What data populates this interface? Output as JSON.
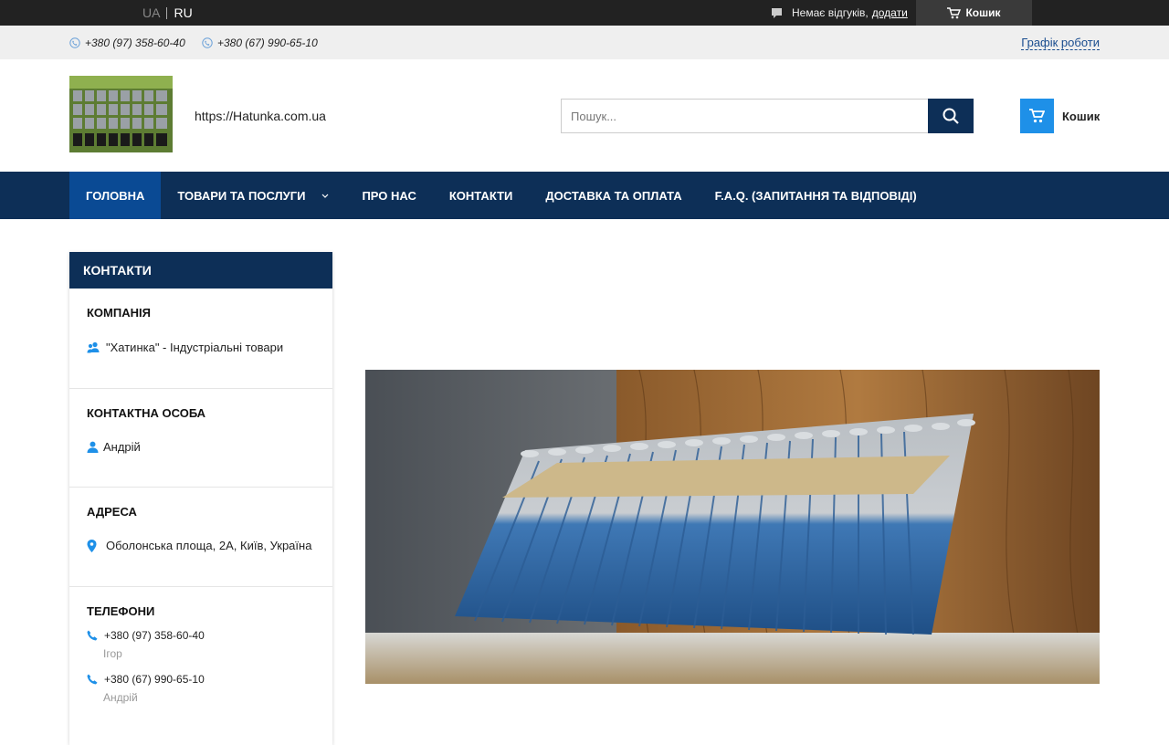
{
  "topbar": {
    "lang_ua": "UA",
    "lang_ru": "RU",
    "reviews_text": "Немає відгуків,",
    "reviews_add": "додати",
    "cart_label": "Кошик"
  },
  "strip": {
    "phone1": "+380 (97) 358-60-40",
    "phone2": "+380 (67) 990-65-10",
    "schedule": "Графік роботи"
  },
  "header": {
    "site_url": "https://Hatunka.com.ua",
    "search_placeholder": "Пошук...",
    "cart_label": "Кошик"
  },
  "nav": {
    "items": [
      {
        "label": "ГОЛОВНА"
      },
      {
        "label": "ТОВАРИ ТА ПОСЛУГИ"
      },
      {
        "label": "ПРО НАС"
      },
      {
        "label": "КОНТАКТИ"
      },
      {
        "label": "ДОСТАВКА ТА ОПЛАТА"
      },
      {
        "label": "F.A.Q. (ЗАПИТАННЯ ТА ВІДПОВІДІ)"
      }
    ]
  },
  "sidebar": {
    "title": "КОНТАКТИ",
    "company_title": "КОМПАНІЯ",
    "company_name": "\"Хатинка\" - Індустріальні товари",
    "person_title": "КОНТАКТНА ОСОБА",
    "person_name": "Андрій",
    "address_title": "АДРЕСА",
    "address": "Оболонська площа, 2А, Київ, Україна",
    "phones_title": "ТЕЛЕФОНИ",
    "phones": [
      {
        "number": "+380 (97) 358-60-40",
        "who": "Ігор"
      },
      {
        "number": "+380 (67) 990-65-10",
        "who": "Андрій"
      }
    ]
  },
  "colors": {
    "brand_dark": "#0d2f57",
    "nav_active": "#0a4a94",
    "accent_blue": "#1e90e8"
  },
  "icons": [
    "chat-icon",
    "cart-icon",
    "phone-icon",
    "search-icon",
    "chevron-down-icon",
    "users-icon",
    "user-icon",
    "map-pin-icon"
  ]
}
